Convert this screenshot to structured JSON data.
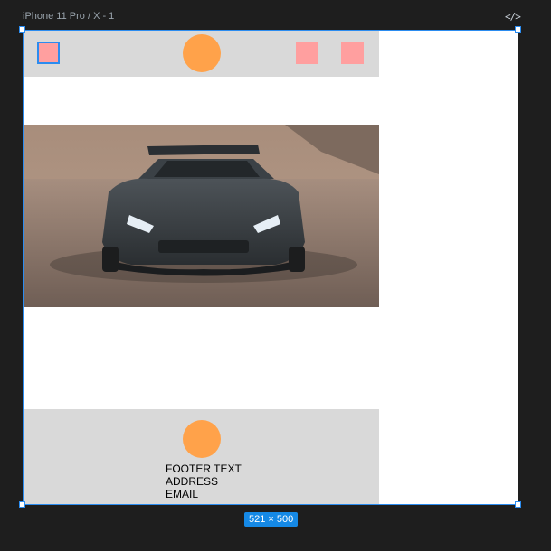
{
  "editor": {
    "frame_label": "iPhone 11 Pro / X - 1",
    "code_icon": "code-icon",
    "code_glyph": "</>",
    "dimensions": "521 × 500",
    "selection_color": "#2b8cf0"
  },
  "design": {
    "colors": {
      "bar_bg": "#d9d9d9",
      "square": "#ff9f9f",
      "circle": "#ffa24a"
    },
    "header": {
      "left_square": "square",
      "center_circle": "circle",
      "right_squares": [
        "square",
        "square"
      ]
    },
    "hero": {
      "image": "sports-car-photo"
    },
    "footer": {
      "circle": "circle",
      "lines": [
        "FOOTER TEXT",
        "ADDRESS",
        "EMAIL"
      ]
    }
  }
}
